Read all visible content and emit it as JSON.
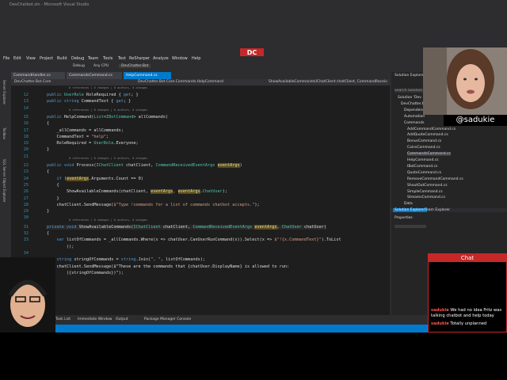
{
  "titlebar": {
    "title": "DevChatbot.sln - Microsoft Visual Studio"
  },
  "brand_logo": "DC",
  "menu": [
    "File",
    "Edit",
    "View",
    "Project",
    "Build",
    "Debug",
    "Team",
    "Tools",
    "Test",
    "ReSharper",
    "Analyze",
    "Window",
    "Help"
  ],
  "toolbar": {
    "config": "Debug",
    "platform": "Any CPU",
    "startup": "DevChatter.Bot"
  },
  "tabs": [
    "CommandHandler.cs",
    "CommandsCommand.cs",
    "HelpCommand.cs"
  ],
  "navbar": {
    "project": "DevChatter.Bot.Core",
    "class": "DevChatter.Bot.Core.Commands.HelpCommand",
    "member": "ShowAvailableCommands(IChatClient chatClient, CommandReceivedEventArgs"
  },
  "code_lines": [
    {
      "n": "12",
      "text": "public UserRole RoleRequired { get; }"
    },
    {
      "n": "13",
      "text": "public string CommandText { get; }"
    },
    {
      "n": "14",
      "text": ""
    },
    {
      "n": "15",
      "text": "public HelpCommand(List<IBotCommand> allCommands)"
    },
    {
      "n": "16",
      "text": "{"
    },
    {
      "n": "17",
      "text": "    _allCommands = allCommands;"
    },
    {
      "n": "18",
      "text": "    CommandText = \"help\";"
    },
    {
      "n": "19",
      "text": "    RoleRequired = UserRole.Everyone;"
    },
    {
      "n": "20",
      "text": "}"
    },
    {
      "n": "21",
      "text": ""
    },
    {
      "n": "22",
      "text": "public void Process(IChatClient chatClient, CommandReceivedEventArgs eventArgs)"
    },
    {
      "n": "23",
      "text": "{"
    },
    {
      "n": "24",
      "text": "    if (eventArgs.Arguments.Count == 0)"
    },
    {
      "n": "25",
      "text": "    {"
    },
    {
      "n": "26",
      "text": "        ShowAvailableCommands(chatClient, eventArgs, eventArgs.ChatUser);"
    },
    {
      "n": "27",
      "text": "    }"
    },
    {
      "n": "28",
      "text": "    chatClient.SendMessage($\"Type !commands for a list of commands chatbot accepts.\");"
    },
    {
      "n": "29",
      "text": "}"
    },
    {
      "n": "30",
      "text": ""
    },
    {
      "n": "31",
      "text": "private void ShowAvailableCommands(IChatClient chatClient, CommandReceivedEventArgs eventArgs, ChatUser chatUser)"
    },
    {
      "n": "32",
      "text": "{"
    },
    {
      "n": "33",
      "text": "    var listOfCommands = _allCommands.Where(x => chatUser.CanUserRunCommand(x)).Select(x => $\"!{x.CommandText}\").ToList"
    },
    {
      "n": "",
      "text": "        ();"
    },
    {
      "n": "34",
      "text": ""
    },
    {
      "n": "35",
      "text": "    string stringOfCommands = string.Join(\", \", listOfCommands);"
    },
    {
      "n": "36",
      "text": "    chatClient.SendMessage($\"These are the commands that {chatUser.DisplayName} is allowed to run:"
    },
    {
      "n": "",
      "text": "        ({stringOfCommands})\");"
    },
    {
      "n": "37",
      "text": "}"
    },
    {
      "n": "38",
      "text": "}"
    },
    {
      "n": "39",
      "text": "}"
    }
  ],
  "codelens": "0 references | 0 changes | 0 authors, 0 changes",
  "solution_explorer": {
    "title": "Solution Explorer",
    "search_placeholder": "Search Solution Explorer (Ctrl+;)",
    "items": [
      "Solution 'Dev",
      "DevChatter.Bot",
      "Dependencies",
      "Automation",
      "Commands",
      "AddCommandCommand.cs",
      "AddQuoteCommand.cs",
      "BonusCommand.cs",
      "CoinsCommand.cs",
      "CommandsCommand.cs",
      "HelpCommand.cs",
      "IBotCommand.cs",
      "QuoteCommand.cs",
      "RemoveCommandCommand.cs",
      "ShoutOutCommand.cs",
      "SimpleCommand.cs",
      "StreamsCommand.cs",
      "Data"
    ],
    "tabs": [
      "Solution Explorer",
      "Team Explorer"
    ]
  },
  "properties": {
    "title": "Properties"
  },
  "bottom_tabs": [
    "Error List",
    "Task List",
    "Immediate Window",
    "Output",
    "Package Manager Console"
  ],
  "handle": "@sadukie",
  "chat": {
    "title": "Chat",
    "messages": [
      {
        "user": "sadukie",
        "text": "We had no idea Fritz was talking chatbot and help today"
      },
      {
        "user": "sadukie",
        "text": "Totally unplanned"
      }
    ]
  },
  "colors": {
    "accent": "#007acc",
    "chat_border": "#c62828",
    "editor_bg": "#1e1e1e"
  }
}
